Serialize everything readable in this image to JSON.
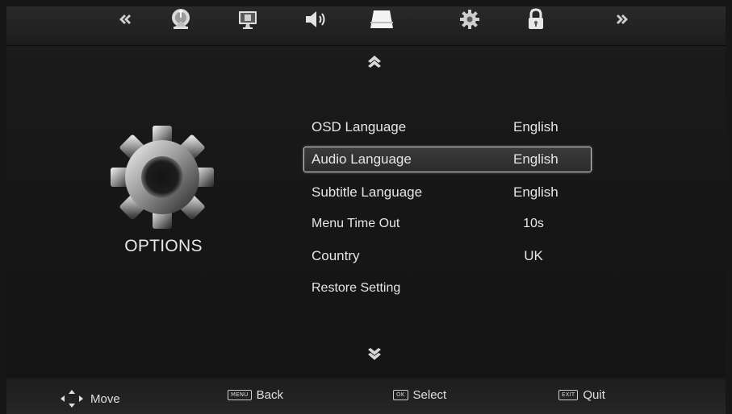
{
  "top_nav": {
    "items": [
      {
        "icon": "double-chevron-left-icon"
      },
      {
        "icon": "satellite-dish-icon"
      },
      {
        "icon": "picture-icon"
      },
      {
        "icon": "speaker-icon"
      },
      {
        "icon": "screen-icon"
      },
      {
        "icon": "gear-icon"
      },
      {
        "icon": "lock-icon"
      },
      {
        "icon": "double-chevron-right-icon"
      }
    ],
    "active_icon": "screen-icon"
  },
  "section": {
    "title": "OPTIONS",
    "icon": "gear-icon"
  },
  "menu": {
    "selected_index": 1,
    "items": [
      {
        "label": "OSD Language",
        "value": "English"
      },
      {
        "label": "Audio Language",
        "value": "English"
      },
      {
        "label": "Subtitle Language",
        "value": "English"
      },
      {
        "label": "Menu Time Out",
        "value": "10s"
      },
      {
        "label": "Country",
        "value": "UK"
      },
      {
        "label": "Restore Setting",
        "value": ""
      }
    ]
  },
  "scroll": {
    "up_icon": "double-chevron-up-icon",
    "down_icon": "double-chevron-down-icon"
  },
  "hints": {
    "move": {
      "icon": "dpad-icon",
      "label": "Move"
    },
    "back": {
      "key": "MENU",
      "label": "Back"
    },
    "select": {
      "key": "OK",
      "label": "Select"
    },
    "quit": {
      "key": "EXIT",
      "label": "Quit"
    }
  },
  "colors": {
    "background": "#171717",
    "text": "#e6e6e6",
    "highlight_border": "#cfcfcf"
  }
}
